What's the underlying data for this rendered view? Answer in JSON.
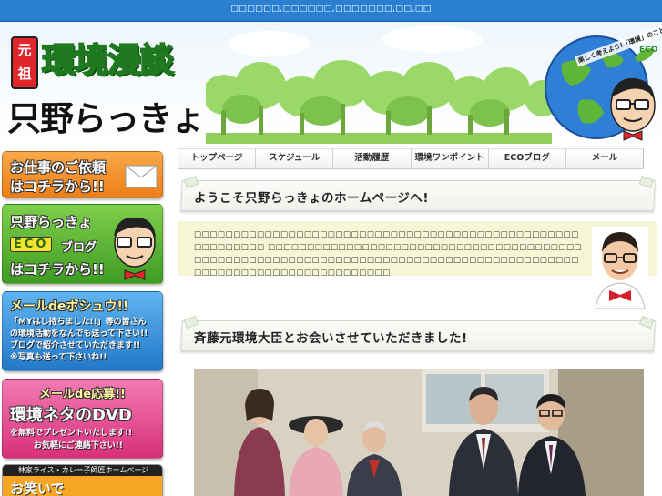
{
  "topbar": {
    "text": "□□□□□□,□□□□□□,□□□□□□□,□□,□□"
  },
  "logo": {
    "badge": "元祖",
    "title1": "環境漫談",
    "title2": "只野らっきょ"
  },
  "globe": {
    "caption": "楽しく考えよう!「環境」のこと",
    "eco_label": "ECO"
  },
  "sidebar": {
    "banner1": {
      "line1": "お仕事のご依頼",
      "line2": "はコチラから!!"
    },
    "banner2": {
      "line1": "只野らっきょ",
      "eco": "ECO",
      "blog": "ブログ",
      "line3": "はコチラから!!"
    },
    "banner3": {
      "title": "メールdeボシュウ!!",
      "line1": "「MYはし持ちました!!」等の皆さん",
      "line2": "の環境活動をなんでも送って下さい!!",
      "line3": "ブログで紹介させていただきます!!",
      "line4": "※写真も送って下さいね!!"
    },
    "banner4": {
      "title": "メールde応募!!",
      "big": "環境ネタのDVD",
      "line1": "を無料でプレゼントいたします!!",
      "line2": "お気軽にご連絡下さい!!"
    },
    "banner5": {
      "caption": "林家ライス・カレー子師匠ホームページ",
      "big": "お笑いで"
    }
  },
  "nav": {
    "items": [
      {
        "label": "トップページ"
      },
      {
        "label": "スケジュール"
      },
      {
        "label": "活動履歴"
      },
      {
        "label": "環境ワンポイント"
      },
      {
        "label": "ECOブログ"
      },
      {
        "label": "メール"
      }
    ]
  },
  "main": {
    "welcome_heading": "ようこそ只野らっきょのホームページへ!",
    "intro_text": "□□□□□□□□□□□□□□□□□□□□□□□□□□□□□□□□□□□□□□□□□□□□□□□□□□□□□□□□□□ □□□□□□□□□□□□□□□□□□□□□□□□□□□□□□□□□□□□□□□□□□□□□□□□□□□□□□□□□□□□□□□□□□□□□□□□□□□□□□□□□□□□□□□□□□□□□□□□□□□□□□□□□□□□□□□□□□",
    "news_heading": "斉藤元環境大臣とお会いさせていただきました!"
  },
  "colors": {
    "topbar": "#2a7fd0",
    "banner_orange": "#f08c1e",
    "banner_green": "#57b032",
    "banner_blue": "#2f8fd8",
    "banner_pink": "#e8408a",
    "intro_bg": "#f7f6d6"
  }
}
